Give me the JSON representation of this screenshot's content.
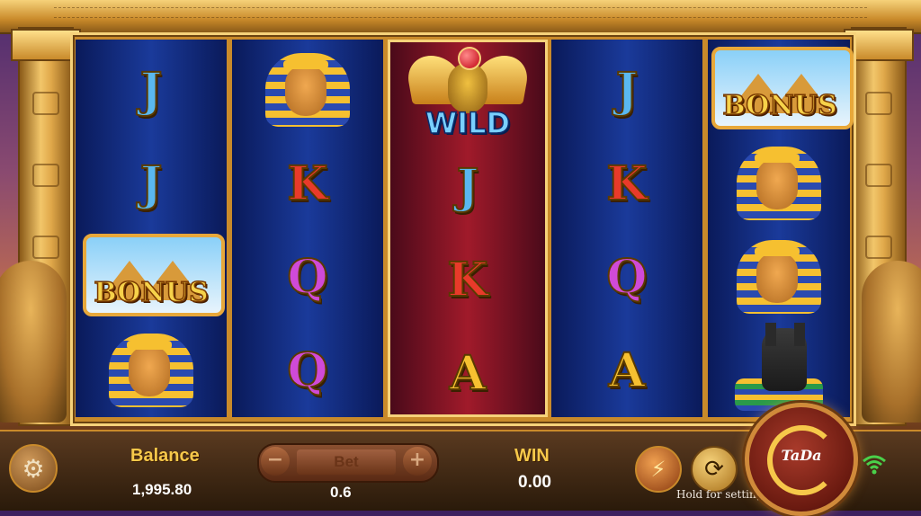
{
  "reels": [
    [
      "J",
      "J",
      "BONUS",
      "PHARAOH"
    ],
    [
      "PHARAOH",
      "K",
      "Q",
      "Q"
    ],
    [
      "WILD",
      "J",
      "K",
      "A"
    ],
    [
      "J",
      "K",
      "Q",
      "A"
    ],
    [
      "BONUS",
      "PHARAOH",
      "PHARAOH",
      "ANUBIS"
    ]
  ],
  "symbols": {
    "J": "J",
    "K": "K",
    "Q": "Q",
    "A": "A",
    "bonus_label": "BONUS",
    "wild_label": "WILD"
  },
  "hud": {
    "balance_label": "Balance",
    "balance_value": "1,995.80",
    "bet_minus": "−",
    "bet_plus": "+",
    "bet_label": "Bet",
    "bet_value": "0.6",
    "win_label": "WIN",
    "win_value": "0.00",
    "hold_text": "Hold for setting",
    "spin_label": "TaDa"
  },
  "icons": {
    "settings": "gear-icon",
    "turbo": "lightning-icon",
    "autoplay": "autoplay-icon",
    "spin": "spin-icon",
    "signal": "wifi-icon"
  },
  "colors": {
    "reel_blue": "#1a3a9a",
    "reel_red": "#a01a2a",
    "gold": "#f6c84a",
    "signal_green": "#4ad04a"
  }
}
